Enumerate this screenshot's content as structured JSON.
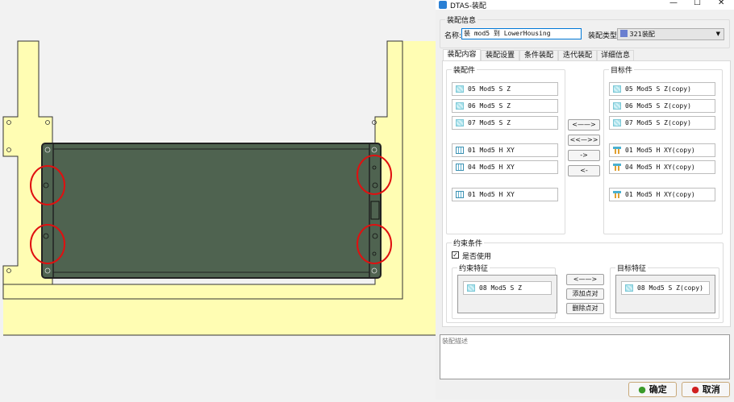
{
  "window": {
    "title": "DTAS-装配",
    "minimize_icon": "minimize",
    "maximize_icon": "maximize",
    "close_icon": "close"
  },
  "info": {
    "group_label": "装配信息",
    "name_label": "名称:",
    "name_value": "装 mod5 到 LowerHousing",
    "type_label": "装配类型:",
    "type_value": "321装配"
  },
  "tabs": [
    {
      "label": "装配内容",
      "active": true
    },
    {
      "label": "装配设置"
    },
    {
      "label": "条件装配"
    },
    {
      "label": "迭代装配"
    },
    {
      "label": "详细信息"
    }
  ],
  "parts": {
    "label": "装配件",
    "items": [
      {
        "icon": "surface",
        "text": "05 Mod5 S Z"
      },
      {
        "icon": "surface",
        "text": "06 Mod5 S Z"
      },
      {
        "icon": "surface",
        "text": "07 Mod5 S Z"
      },
      {
        "icon": "hole",
        "text": "01 Mod5 H XY"
      },
      {
        "icon": "hole",
        "text": "04 Mod5 H XY"
      },
      {
        "icon": "hole",
        "text": "01 Mod5 H XY"
      }
    ]
  },
  "targets": {
    "label": "目标件",
    "items": [
      {
        "icon": "surface",
        "text": "05 Mod5 S Z(copy)"
      },
      {
        "icon": "surface",
        "text": "06 Mod5 S Z(copy)"
      },
      {
        "icon": "surface",
        "text": "07 Mod5 S Z(copy)"
      },
      {
        "icon": "pin",
        "text": "01 Mod5 H XY(copy)"
      },
      {
        "icon": "pin",
        "text": "04 Mod5 H XY(copy)"
      },
      {
        "icon": "pin",
        "text": "01 Mod5 H XY(copy)"
      }
    ]
  },
  "middle_buttons": [
    "<——>",
    "<<—>>",
    "->",
    "<-"
  ],
  "constraint": {
    "label": "约束条件",
    "use_label": "是否使用",
    "use_checked": true,
    "feature_label": "约束特征",
    "feature_item": "08 Mod5 S Z",
    "target_label": "目标特征",
    "target_item": "08 Mod5 S Z(copy)",
    "buttons": [
      "<——>",
      "添加点对",
      "删除点对"
    ]
  },
  "description": {
    "placeholder": "装配描述"
  },
  "footer": {
    "ok": "确定",
    "cancel": "取消"
  },
  "colors": {
    "part_fill": "#4f6350",
    "frame_fill": "#fffdb3",
    "highlight": "#e01010"
  }
}
